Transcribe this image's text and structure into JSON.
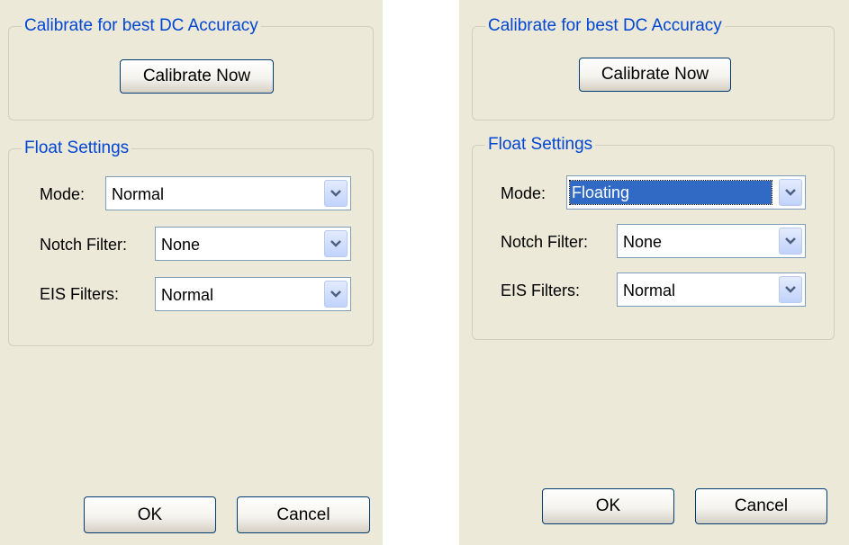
{
  "panels": [
    {
      "calibrate_group": {
        "title": "Calibrate for best DC Accuracy",
        "button_label": "Calibrate Now"
      },
      "float_group": {
        "title": "Float Settings",
        "mode": {
          "label": "Mode:",
          "value": "Normal",
          "selected": false
        },
        "notch": {
          "label": "Notch Filter:",
          "value": "None"
        },
        "eis": {
          "label": "EIS Filters:",
          "value": "Normal"
        }
      },
      "ok_label": "OK",
      "cancel_label": "Cancel"
    },
    {
      "calibrate_group": {
        "title": "Calibrate for best DC Accuracy",
        "button_label": "Calibrate Now"
      },
      "float_group": {
        "title": "Float Settings",
        "mode": {
          "label": "Mode:",
          "value": "Floating",
          "selected": true
        },
        "notch": {
          "label": "Notch Filter:",
          "value": "None"
        },
        "eis": {
          "label": "EIS Filters:",
          "value": "Normal"
        }
      },
      "ok_label": "OK",
      "cancel_label": "Cancel"
    }
  ],
  "colors": {
    "panel_bg": "#ece9d8",
    "group_title": "#0046d5",
    "selection": "#316ac5"
  },
  "icons": {
    "dropdown": "chevron-down-icon"
  }
}
